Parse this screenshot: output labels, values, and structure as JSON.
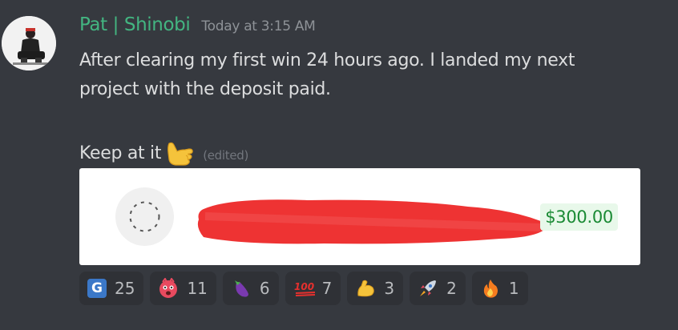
{
  "message": {
    "username": "Pat | Shinobi",
    "timestamp": "Today at 3:15 AM",
    "line1": "After clearing my first win 24 hours ago. I landed my next",
    "line2": "project with the deposit paid.",
    "keep_text": "Keep at it",
    "keep_emoji": "call-me-hand",
    "edited": "(edited)"
  },
  "embed": {
    "amount": "$300.00",
    "amount_color": "#1a8a34"
  },
  "reactions": [
    {
      "emoji": "g-letter-icon",
      "letter": "G",
      "count": "25"
    },
    {
      "emoji": "exploding-head-icon",
      "count": "11"
    },
    {
      "emoji": "eggplant-icon",
      "count": "6"
    },
    {
      "emoji": "hundred-points-icon",
      "count": "7"
    },
    {
      "emoji": "flexed-biceps-icon",
      "count": "3"
    },
    {
      "emoji": "rocket-icon",
      "count": "2"
    },
    {
      "emoji": "fire-icon",
      "count": "1"
    }
  ],
  "colors": {
    "background": "#36393f",
    "username": "#43b581",
    "reaction_bg": "#2f3136"
  }
}
